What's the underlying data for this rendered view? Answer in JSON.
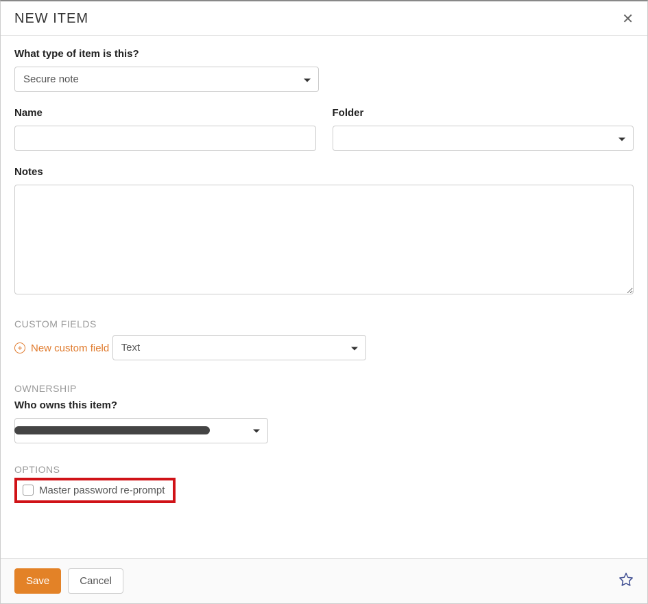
{
  "header": {
    "title": "NEW ITEM"
  },
  "form": {
    "type_label": "What type of item is this?",
    "type_value": "Secure note",
    "name_label": "Name",
    "name_value": "",
    "folder_label": "Folder",
    "folder_value": "",
    "notes_label": "Notes",
    "notes_value": ""
  },
  "custom_fields": {
    "section_title": "CUSTOM FIELDS",
    "add_label": "New custom field",
    "type_value": "Text"
  },
  "ownership": {
    "section_title": "OWNERSHIP",
    "label": "Who owns this item?",
    "value": ""
  },
  "options": {
    "section_title": "OPTIONS",
    "reprompt_label": "Master password re-prompt",
    "reprompt_checked": false
  },
  "footer": {
    "save_label": "Save",
    "cancel_label": "Cancel"
  }
}
